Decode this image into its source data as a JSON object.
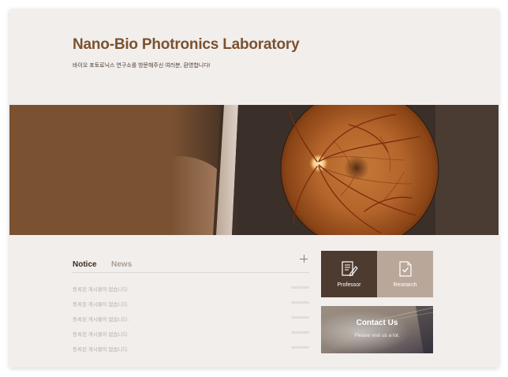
{
  "header": {
    "title": "Nano-Bio Photronics Laboratory",
    "subtitle": "바이오 포토로닉스 연구소를 방문해주신 여러분, 환영합니다!"
  },
  "hero": {
    "image": "retina-fundus-photo"
  },
  "board": {
    "tabs": [
      "Notice",
      "News"
    ],
    "active_tab": "Notice",
    "rows": [
      {
        "text": "등록된 게시물이 없습니다.",
        "date": "0000/00/00"
      },
      {
        "text": "등록된 게시물이 없습니다.",
        "date": "0000/00/00"
      },
      {
        "text": "등록된 게시물이 없습니다.",
        "date": "0000/00/00"
      },
      {
        "text": "등록된 게시물이 없습니다.",
        "date": "0000/00/00"
      },
      {
        "text": "등록된 게시물이 없습니다.",
        "date": "0000/00/00"
      }
    ]
  },
  "quick_links": [
    {
      "label": "Professor",
      "icon": "document-pen-icon"
    },
    {
      "label": "Research",
      "icon": "document-check-icon"
    }
  ],
  "contact": {
    "title": "Contact Us",
    "subtitle": "Please visit us a lot."
  },
  "colors": {
    "brand": "#7a5230",
    "professor_bg": "#4e3b30",
    "research_bg": "#b9a79a",
    "page_bg": "#f2eeeb"
  }
}
